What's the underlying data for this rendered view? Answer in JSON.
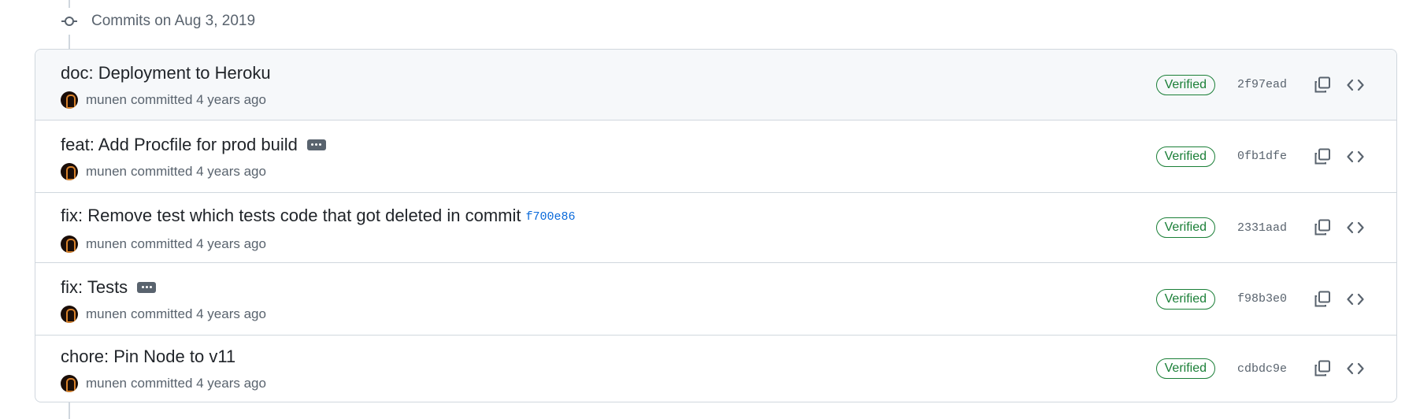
{
  "timeline": {
    "header": "Commits on Aug 3, 2019"
  },
  "commits": [
    {
      "title": "doc: Deployment to Heroku",
      "link": "",
      "has_ellipsis": false,
      "author": "munen",
      "action_time": "committed 4 years ago",
      "badge": "Verified",
      "sha": "2f97ead"
    },
    {
      "title": "feat: Add Procfile for prod build",
      "link": "",
      "has_ellipsis": true,
      "author": "munen",
      "action_time": "committed 4 years ago",
      "badge": "Verified",
      "sha": "0fb1dfe"
    },
    {
      "title": "fix: Remove test which tests code that got deleted in commit",
      "link": "f700e86",
      "has_ellipsis": false,
      "author": "munen",
      "action_time": "committed 4 years ago",
      "badge": "Verified",
      "sha": "2331aad"
    },
    {
      "title": "fix: Tests",
      "link": "",
      "has_ellipsis": true,
      "author": "munen",
      "action_time": "committed 4 years ago",
      "badge": "Verified",
      "sha": "f98b3e0"
    },
    {
      "title": "chore: Pin Node to v11",
      "link": "",
      "has_ellipsis": false,
      "author": "munen",
      "action_time": "committed 4 years ago",
      "badge": "Verified",
      "sha": "cdbdc9e"
    }
  ],
  "icons": {
    "commit": "git-commit-icon",
    "copy": "copy-icon",
    "browse": "code-icon"
  },
  "colors": {
    "verified": "#1a7f37",
    "link": "#0969da",
    "muted": "#59636e",
    "border": "#d0d7de"
  }
}
